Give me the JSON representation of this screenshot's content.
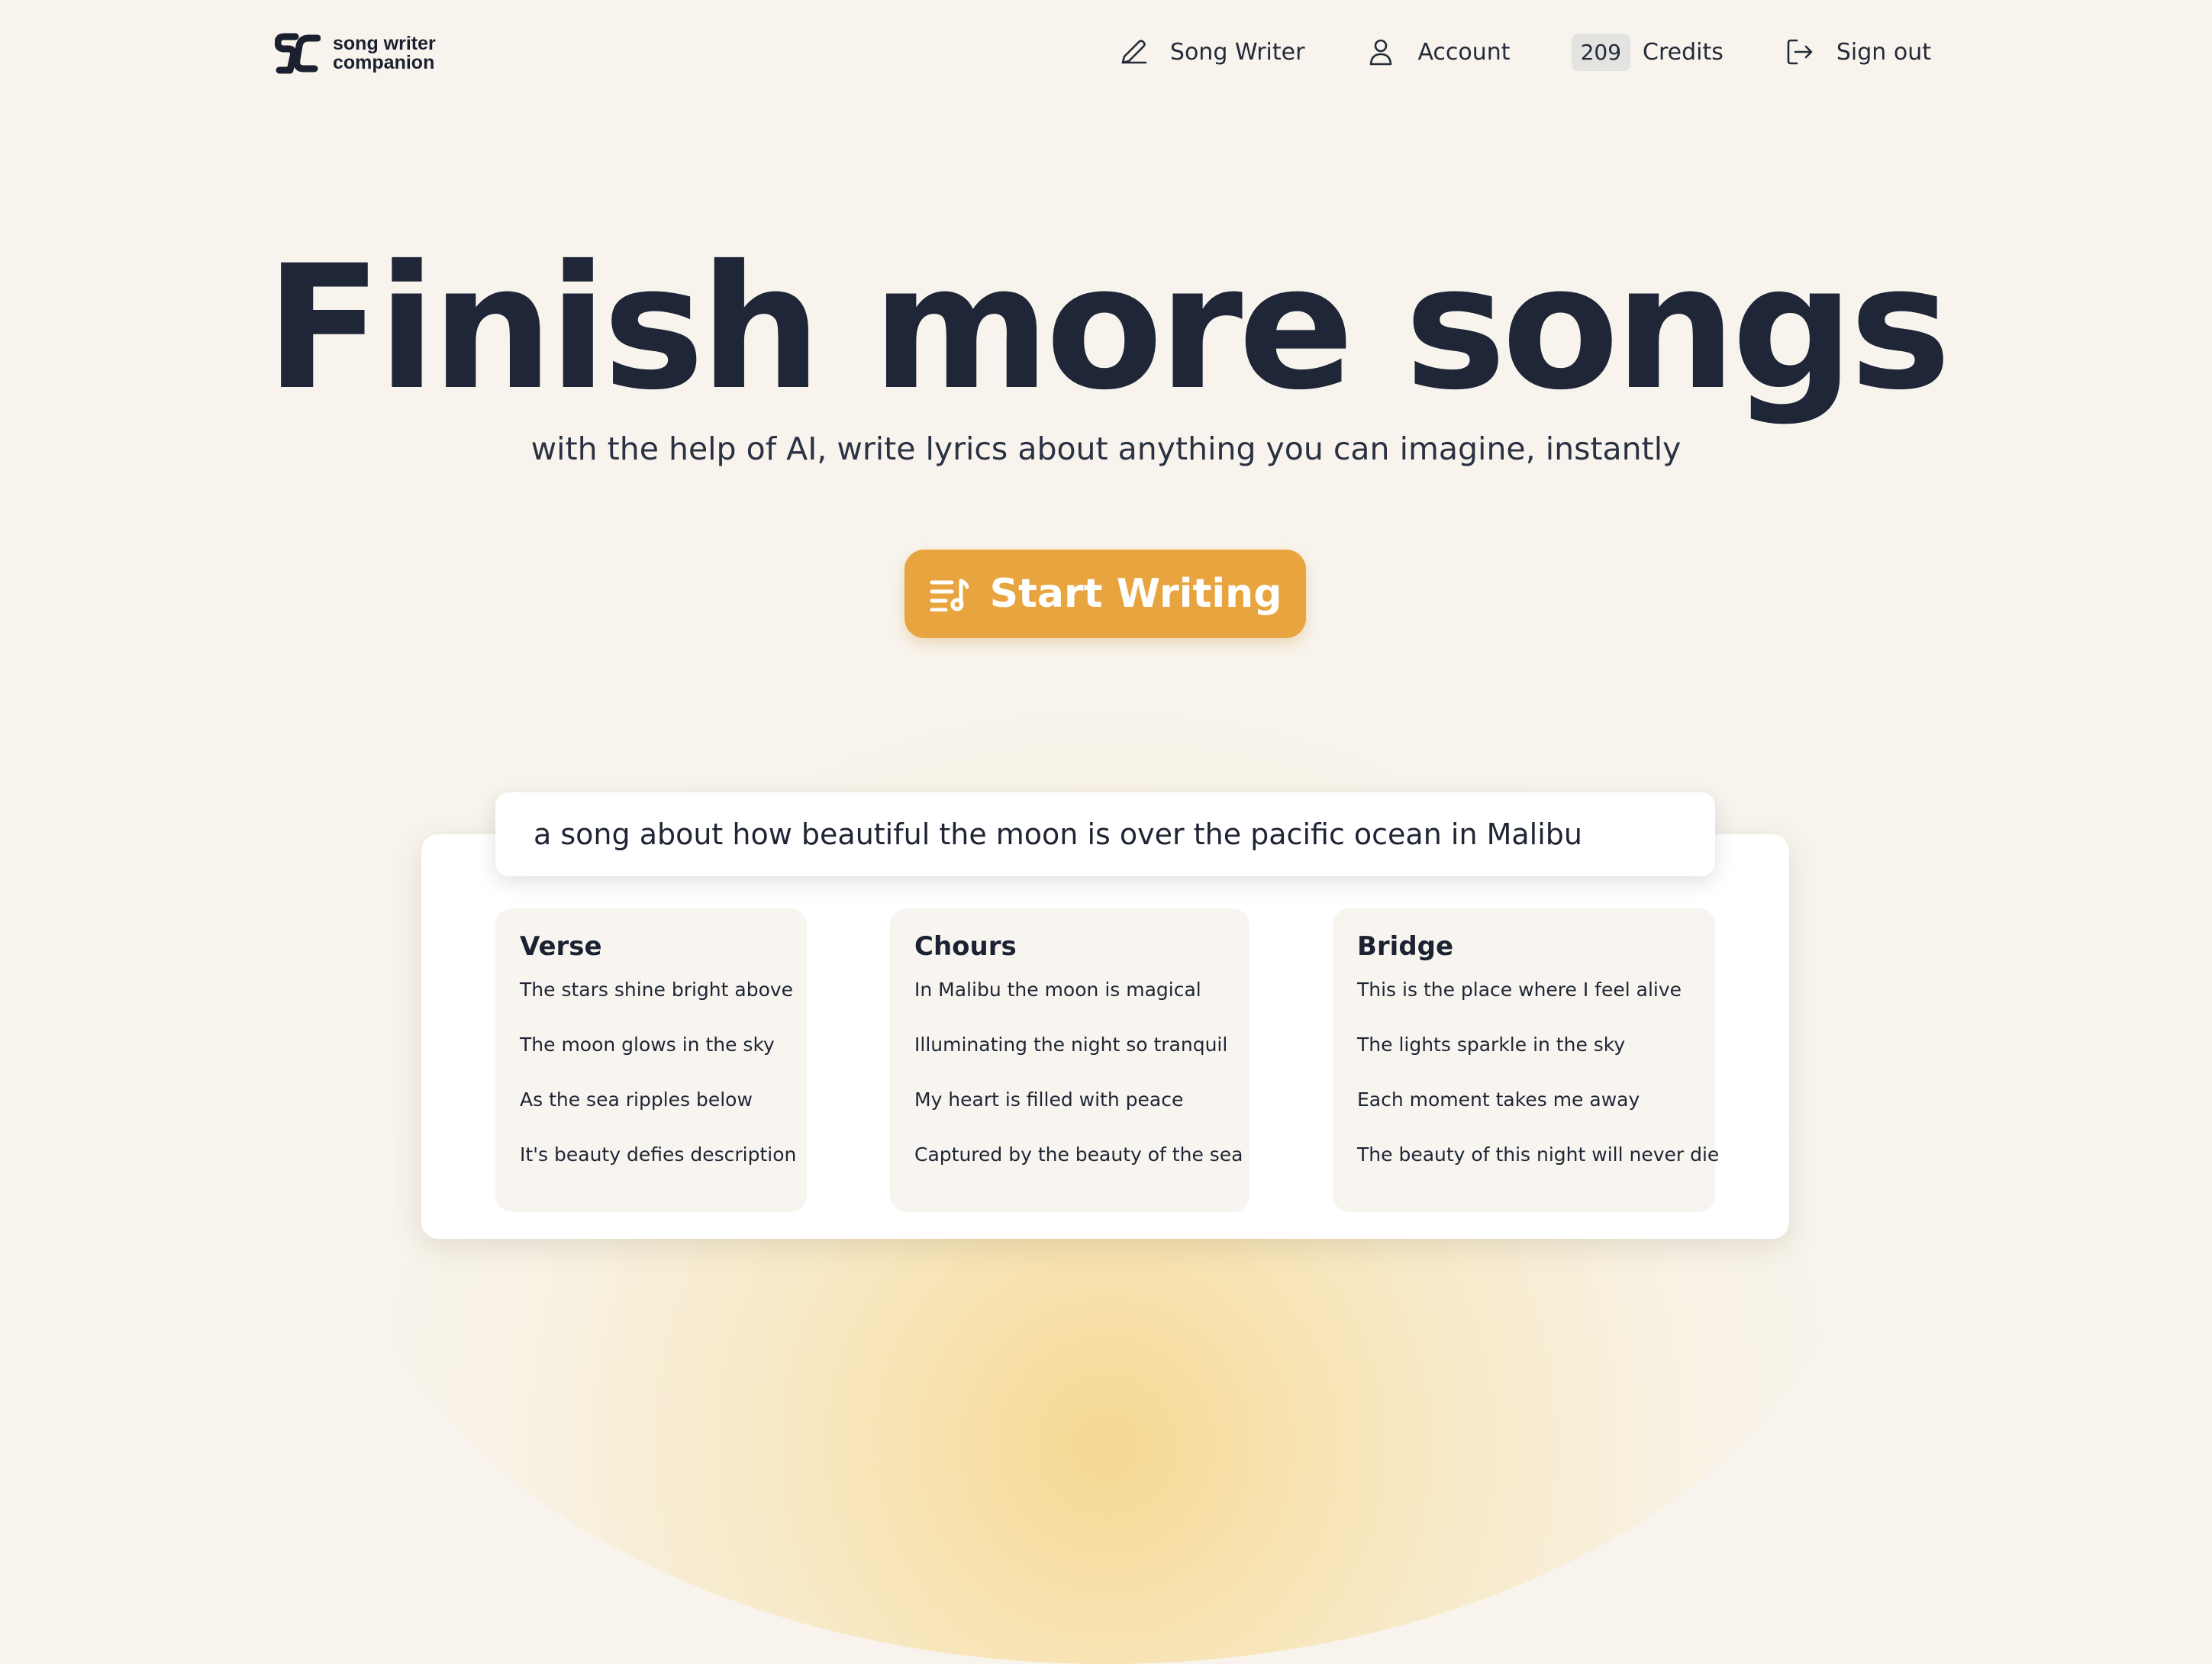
{
  "brand": {
    "line1": "song writer",
    "line2": "companion",
    "logo_icon": "sc-monogram-logo"
  },
  "nav": {
    "items": [
      {
        "label": "Song Writer",
        "icon": "pencil-icon"
      },
      {
        "label": "Account",
        "icon": "user-icon"
      },
      {
        "label": "Credits",
        "badge": "209"
      },
      {
        "label": "Sign out",
        "icon": "sign-out-icon"
      }
    ]
  },
  "hero": {
    "title": "Finish more songs",
    "subtitle": "with the help of AI, write lyrics about anything you can imagine, instantly",
    "cta_label": "Start Writing",
    "cta_icon": "playlist-music-icon"
  },
  "demo": {
    "prompt": "a song about how beautiful the moon is over the pacific ocean in Malibu",
    "sections": [
      {
        "title": "Verse",
        "lines": [
          "The stars shine bright above",
          "The moon glows in the sky",
          "As the sea ripples below",
          "It's beauty defies description"
        ]
      },
      {
        "title": "Chours",
        "lines": [
          "In Malibu the moon is magical",
          "Illuminating the night so tranquil",
          "My heart is filled with peace",
          "Captured by the beauty of the sea"
        ]
      },
      {
        "title": "Bridge",
        "lines": [
          "This is the place where I feel alive",
          "The lights sparkle in the sky",
          "Each moment takes me away",
          "The beauty of this night will never die"
        ]
      }
    ]
  },
  "colors": {
    "background": "#f8f4ed",
    "accent": "#e8a43e",
    "text": "#1e2637"
  }
}
